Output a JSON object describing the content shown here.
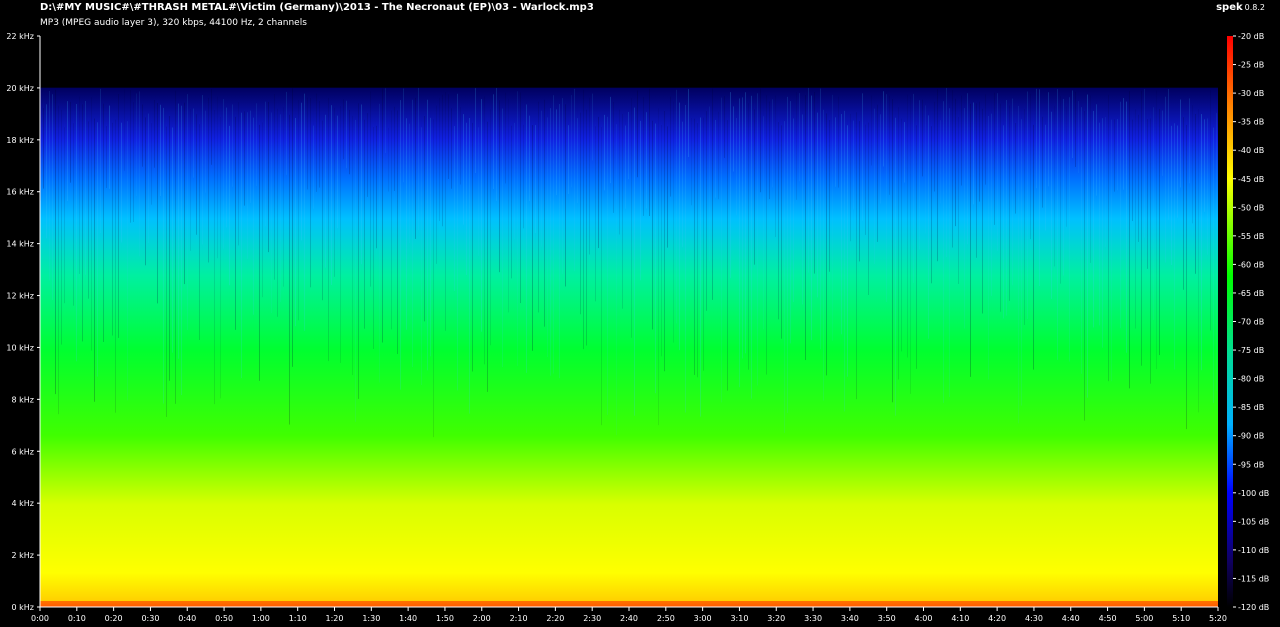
{
  "header": {
    "title": "D:\\#MY MUSIC#\\#THRASH METAL#\\Victim (Germany)\\2013 - The Necronaut (EP)\\03 - Warlock.mp3",
    "info": "MP3 (MPEG audio layer 3), 320 kbps, 44100 Hz, 2 channels"
  },
  "brand": {
    "name": "spek",
    "version": "0.8.2"
  },
  "chart_data": {
    "type": "heatmap",
    "title": "",
    "xlabel": "",
    "ylabel": "",
    "x_unit": "seconds",
    "xlim": [
      0,
      320
    ],
    "ylim": [
      0,
      22
    ],
    "grid": false,
    "freq_ticks": [
      "0 kHz",
      "2 kHz",
      "4 kHz",
      "6 kHz",
      "8 kHz",
      "10 kHz",
      "12 kHz",
      "14 kHz",
      "16 kHz",
      "18 kHz",
      "20 kHz",
      "22 kHz"
    ],
    "freq_tick_values": [
      0,
      2,
      4,
      6,
      8,
      10,
      12,
      14,
      16,
      18,
      20,
      22
    ],
    "time_ticks": [
      "0:00",
      "0:10",
      "0:20",
      "0:30",
      "0:40",
      "0:50",
      "1:00",
      "1:10",
      "1:20",
      "1:30",
      "1:40",
      "1:50",
      "2:00",
      "2:10",
      "2:20",
      "2:30",
      "2:40",
      "2:50",
      "3:00",
      "3:10",
      "3:20",
      "3:30",
      "3:40",
      "3:50",
      "4:00",
      "4:10",
      "4:20",
      "4:30",
      "4:40",
      "4:50",
      "5:00",
      "5:10",
      "5:20"
    ],
    "time_tick_values": [
      0,
      10,
      20,
      30,
      40,
      50,
      60,
      70,
      80,
      90,
      100,
      110,
      120,
      130,
      140,
      150,
      160,
      170,
      180,
      190,
      200,
      210,
      220,
      230,
      240,
      250,
      260,
      270,
      280,
      290,
      300,
      310,
      320
    ],
    "db_ticks": [
      "-20 dB",
      "-25 dB",
      "-30 dB",
      "-35 dB",
      "-40 dB",
      "-45 dB",
      "-50 dB",
      "-55 dB",
      "-60 dB",
      "-65 dB",
      "-70 dB",
      "-75 dB",
      "-80 dB",
      "-85 dB",
      "-90 dB",
      "-95 dB",
      "-100 dB",
      "-105 dB",
      "-110 dB",
      "-115 dB",
      "-120 dB"
    ],
    "db_range": [
      -120,
      -20
    ],
    "cutoff_khz": 20,
    "colors": {
      "colormap": [
        "#ff0000",
        "#ff8000",
        "#ffff00",
        "#00ff00",
        "#00c8ff",
        "#0000ff",
        "#000080",
        "#000000"
      ],
      "background": "#000000",
      "text": "#ffffff"
    }
  }
}
